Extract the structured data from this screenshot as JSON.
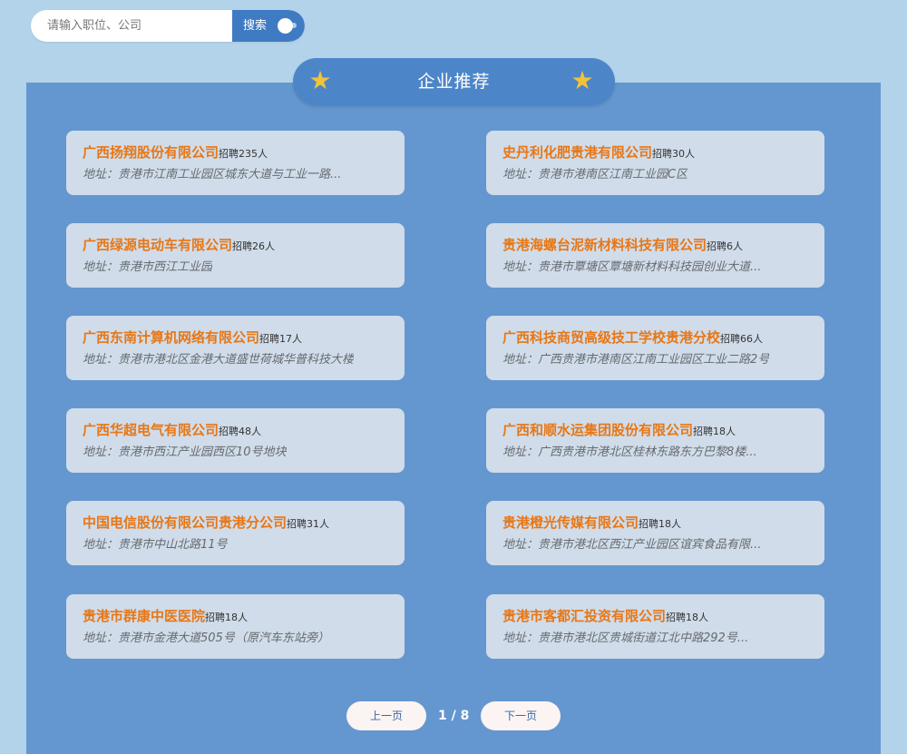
{
  "search": {
    "placeholder": "请输入职位、公司",
    "button_label": "搜索"
  },
  "section": {
    "title": "企业推荐"
  },
  "companies": [
    {
      "name": "广西扬翔股份有限公司",
      "hire": "招聘235人",
      "address": "地址：贵港市江南工业园区城东大道与工业一路..."
    },
    {
      "name": "史丹利化肥贵港有限公司",
      "hire": "招聘30人",
      "address": "地址：贵港市港南区江南工业园C区"
    },
    {
      "name": "广西绿源电动车有限公司",
      "hire": "招聘26人",
      "address": "地址：贵港市西江工业园"
    },
    {
      "name": "贵港海螺台泥新材料科技有限公司",
      "hire": "招聘6人",
      "address": "地址：贵港市覃塘区覃塘新材料科技园创业大道..."
    },
    {
      "name": "广西东南计算机网络有限公司",
      "hire": "招聘17人",
      "address": "地址：贵港市港北区金港大道盛世荷城华普科技大楼"
    },
    {
      "name": "广西科技商贸高级技工学校贵港分校",
      "hire": "招聘66人",
      "address": "地址：广西贵港市港南区江南工业园区工业二路2号"
    },
    {
      "name": "广西华超电气有限公司",
      "hire": "招聘48人",
      "address": "地址：贵港市西江产业园西区10号地块"
    },
    {
      "name": "广西和顺水运集团股份有限公司",
      "hire": "招聘18人",
      "address": "地址：广西贵港市港北区桂林东路东方巴黎8楼..."
    },
    {
      "name": "中国电信股份有限公司贵港分公司",
      "hire": "招聘31人",
      "address": "地址：贵港市中山北路11号"
    },
    {
      "name": "贵港橙光传媒有限公司",
      "hire": "招聘18人",
      "address": "地址：贵港市港北区西江产业园区谊宾食品有限..."
    },
    {
      "name": "贵港市群康中医医院",
      "hire": "招聘18人",
      "address": "地址：贵港市金港大道505号（原汽车东站旁）"
    },
    {
      "name": "贵港市客都汇投资有限公司",
      "hire": "招聘18人",
      "address": "地址：贵港市港北区贵城街道江北中路292号..."
    }
  ],
  "pagination": {
    "prev_label": "上一页",
    "indicator": "1 / 8",
    "next_label": "下一页"
  },
  "colors": {
    "page_background": "#b3d3ea",
    "panel": "#6497d0",
    "header_pill": "#4c86c9",
    "search_button": "#3f7bc3",
    "card": "#d0dce9",
    "company_name": "#e77716",
    "star": "#f3c23b"
  }
}
